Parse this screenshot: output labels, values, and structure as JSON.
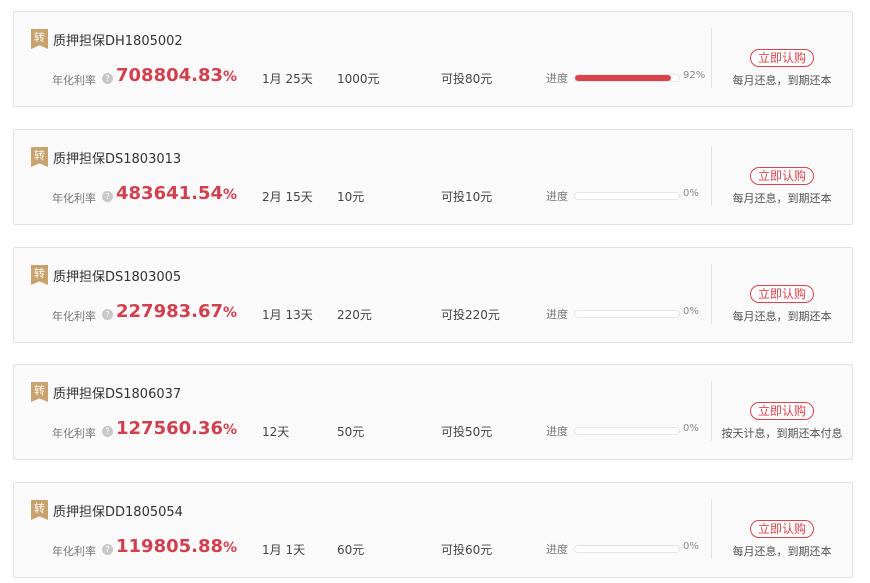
{
  "products": [
    {
      "tag": "转",
      "name": "质押担保DH1805002",
      "rate_label": "年化利率",
      "rate_value": "708804.83",
      "rate_unit": "%",
      "period": "1月 25天",
      "amount": "1000元",
      "available": "可投80元",
      "progress_label": "进度",
      "progress": 92,
      "progress_text": "92%",
      "button": "立即认购",
      "repayment": "每月还息，到期还本"
    },
    {
      "tag": "转",
      "name": "质押担保DS1803013",
      "rate_label": "年化利率",
      "rate_value": "483641.54",
      "rate_unit": "%",
      "period": "2月 15天",
      "amount": "10元",
      "available": "可投10元",
      "progress_label": "进度",
      "progress": 0,
      "progress_text": "0%",
      "button": "立即认购",
      "repayment": "每月还息，到期还本"
    },
    {
      "tag": "转",
      "name": "质押担保DS1803005",
      "rate_label": "年化利率",
      "rate_value": "227983.67",
      "rate_unit": "%",
      "period": "1月 13天",
      "amount": "220元",
      "available": "可投220元",
      "progress_label": "进度",
      "progress": 0,
      "progress_text": "0%",
      "button": "立即认购",
      "repayment": "每月还息，到期还本"
    },
    {
      "tag": "转",
      "name": "质押担保DS1806037",
      "rate_label": "年化利率",
      "rate_value": "127560.36",
      "rate_unit": "%",
      "period": "12天",
      "amount": "50元",
      "available": "可投50元",
      "progress_label": "进度",
      "progress": 0,
      "progress_text": "0%",
      "button": "立即认购",
      "repayment": "按天计息，到期还本付息"
    },
    {
      "tag": "转",
      "name": "质押担保DD1805054",
      "rate_label": "年化利率",
      "rate_value": "119805.88",
      "rate_unit": "%",
      "period": "1月 1天",
      "amount": "60元",
      "available": "可投60元",
      "progress_label": "进度",
      "progress": 0,
      "progress_text": "0%",
      "button": "立即认购",
      "repayment": "每月还息，到期还本"
    }
  ],
  "colors": {
    "accent": "#d9444c",
    "tag": "#c9a36e",
    "card_border": "#e2e2e2"
  },
  "icons": {
    "help": "question-circle-icon",
    "tag": "ribbon-tag-icon"
  }
}
